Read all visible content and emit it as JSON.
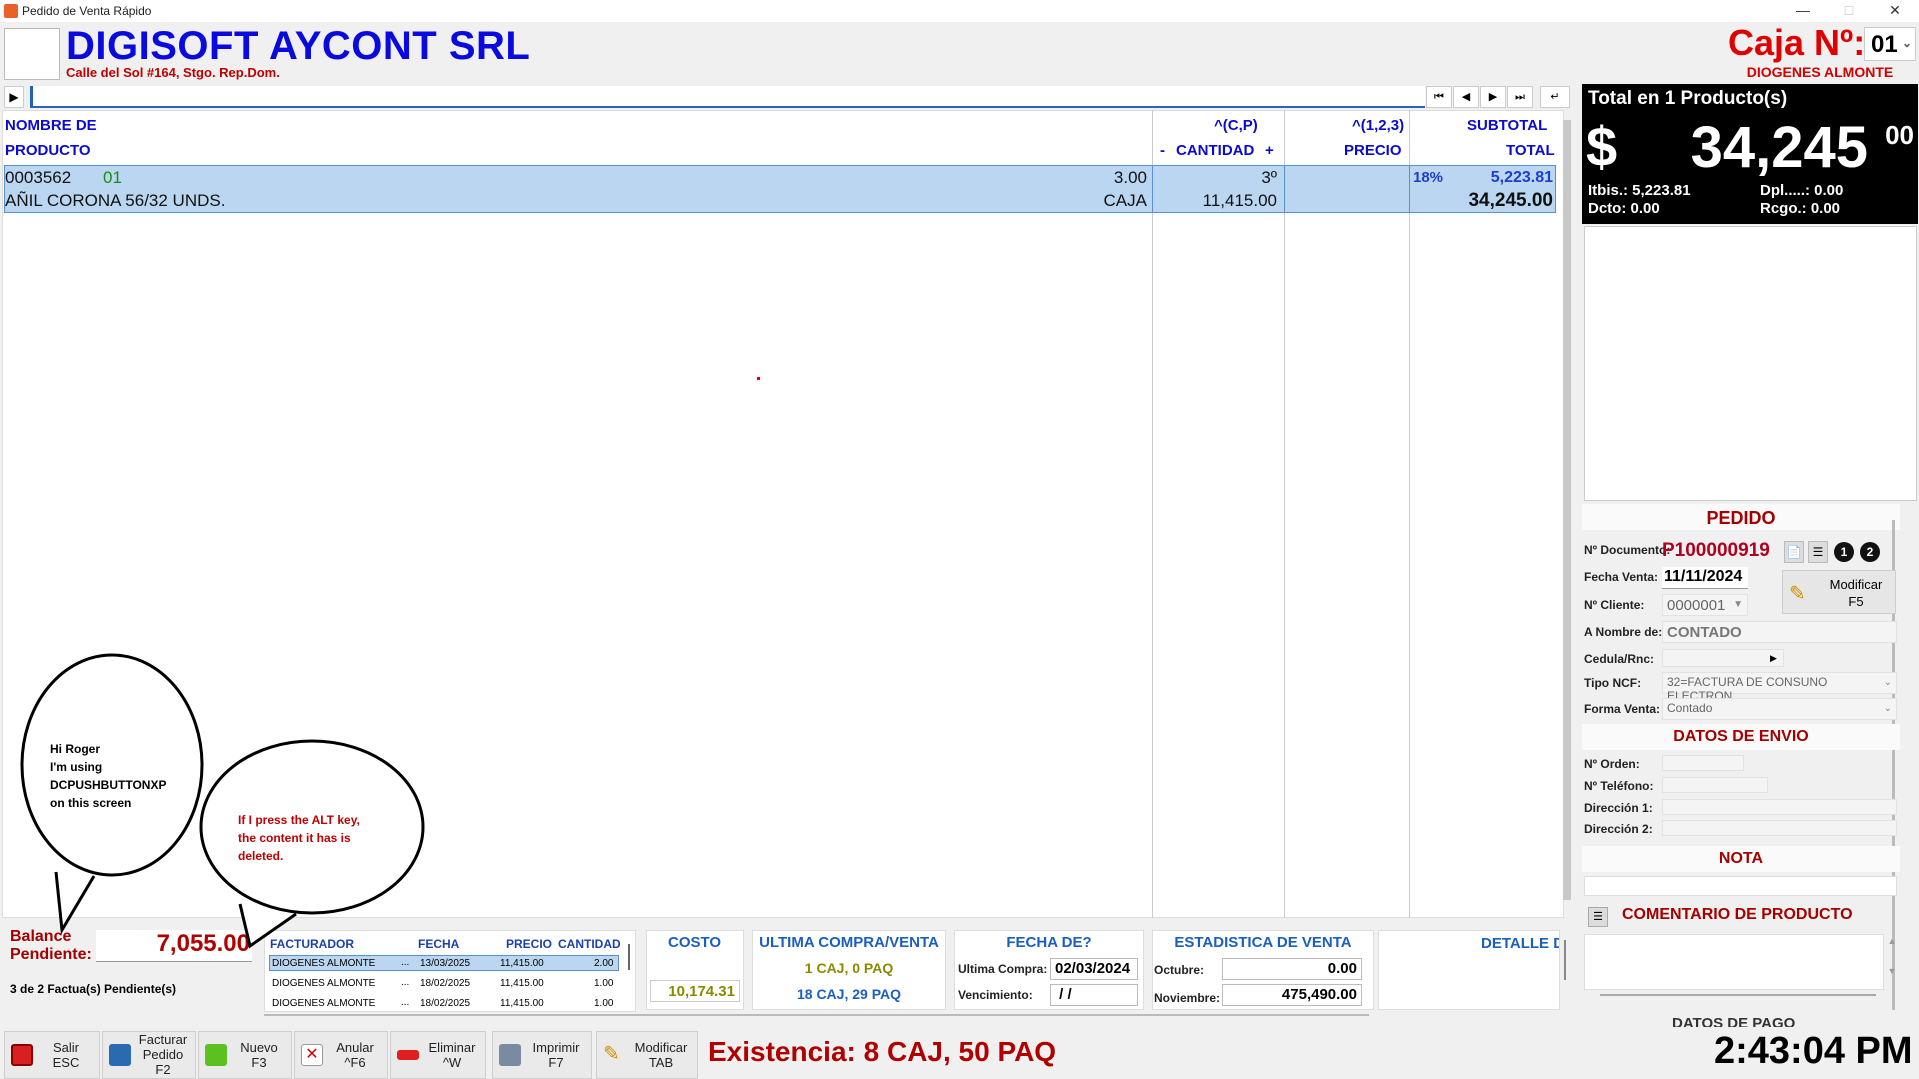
{
  "window": {
    "title": "Pedido de Venta Rápido"
  },
  "header": {
    "company": "DIGISOFT AYCONT SRL",
    "address": "Calle del Sol #164, Stgo. Rep.Dom.",
    "caja_label": "Caja Nº:",
    "caja_value": "01",
    "cashier": "DIOGENES ALMONTE"
  },
  "grid": {
    "headers": {
      "product_1": "NOMBRE DE",
      "product_2": "PRODUCTO",
      "qty_1": "^(C,P)",
      "qty_minus": "-",
      "qty_2": "CANTIDAD",
      "qty_plus": "+",
      "price_1": "^(1,2,3)",
      "price_2": "PRECIO",
      "total_1": "SUBTOTAL",
      "total_2": "TOTAL"
    },
    "rows": [
      {
        "code": "0003562",
        "code_suffix": "01",
        "name": "AÑIL CORONA 56/32 UNDS.",
        "qty": "3.00",
        "unit": "CAJA",
        "price_level": "3º",
        "price": "11,415.00",
        "tax": "18%",
        "subtotal": "5,223.81",
        "total": "34,245.00"
      }
    ]
  },
  "summary": {
    "title": "Total en 1 Producto(s)",
    "currency": "$",
    "amount": "34,245",
    "cents": "00",
    "itbis": "Itbis.: 5,223.81",
    "dpl": "Dpl.....: 0.00",
    "dcto": "Dcto: 0.00",
    "rcgo": "Rcgo.: 0.00"
  },
  "pedido": {
    "title": "PEDIDO",
    "doc_label": "Nº Documento:",
    "doc_value": "P100000919",
    "fecha_label": "Fecha Venta:",
    "fecha_value": "11/11/2024",
    "cliente_label": "Nº Cliente:",
    "cliente_value": "0000001",
    "nombre_label": "A Nombre de:",
    "nombre_value": "CONTADO",
    "cedula_label": "Cedula/Rnc:",
    "ncf_label": "Tipo NCF:",
    "ncf_value": "32=FACTURA DE CONSUNO ELECTRON",
    "forma_label": "Forma Venta:",
    "forma_value": "Contado",
    "modificar_label": "Modificar",
    "modificar_key": "F5"
  },
  "envio": {
    "title": "DATOS DE ENVIO",
    "orden_label": "Nº Orden:",
    "telefono_label": "Nº Teléfono:",
    "dir1_label": "Dirección 1:",
    "dir2_label": "Dirección 2:"
  },
  "nota": {
    "title": "NOTA"
  },
  "comentario": {
    "title": "COMENTARIO DE PRODUCTO"
  },
  "pago": {
    "title": "DATOS DE PAGO"
  },
  "balance": {
    "label_1": "Balance",
    "label_2": "Pendiente:",
    "value": "7,055.00",
    "facturas": "3 de 2 Factua(s) Pendiente(s)"
  },
  "facturador_table": {
    "headers": [
      "FACTURADOR",
      "FECHA",
      "PRECIO",
      "CANTIDAD"
    ],
    "rows": [
      [
        "DIOGENES ALMONTE",
        "13/03/2025",
        "11,415.00",
        "2.00"
      ],
      [
        "DIOGENES ALMONTE",
        "18/02/2025",
        "11,415.00",
        "1.00"
      ],
      [
        "DIOGENES ALMONTE",
        "18/02/2025",
        "11,415.00",
        "1.00"
      ]
    ],
    "ellipsis": "..."
  },
  "costo": {
    "title": "COSTO",
    "value": "10,174.31"
  },
  "ultima": {
    "title": "ULTIMA COMPRA/VENTA",
    "line1": "1 CAJ,  0 PAQ",
    "line2": "18 CAJ, 29 PAQ"
  },
  "fechade": {
    "title": "FECHA DE?",
    "compra_label": "Ultima Compra:",
    "compra_value": "02/03/2024",
    "venc_label": "Vencimiento:",
    "venc_value": " / /"
  },
  "estadistica": {
    "title": "ESTADISTICA DE VENTA",
    "m1_label": "Octubre:",
    "m1_value": "0.00",
    "m2_label": "Noviembre:",
    "m2_value": "475,490.00"
  },
  "detalle": {
    "title": "DETALLE D"
  },
  "bubbles": {
    "one": [
      "Hi Roger",
      "I'm using",
      "DCPUSHBUTTONXP",
      "on this screen"
    ],
    "two": [
      "If I press the ALT key,",
      "the content it has is",
      "deleted."
    ]
  },
  "toolbar": [
    {
      "label": "Salir",
      "key": "ESC"
    },
    {
      "label": "Facturar Pedido",
      "key": "F2"
    },
    {
      "label": "Nuevo",
      "key": "F3"
    },
    {
      "label": "Anular",
      "key": "^F6"
    },
    {
      "label": "Eliminar",
      "key": "^W"
    },
    {
      "label": "Imprimir",
      "key": "F7"
    },
    {
      "label": "Modificar",
      "key": "TAB"
    }
  ],
  "existencia": "Existencia: 8 CAJ, 50 PAQ",
  "clock": "2:43:04 PM",
  "colors": {
    "brand": "#0a0ae0",
    "accent": "#d40000",
    "row_selected": "#bad6f0"
  }
}
